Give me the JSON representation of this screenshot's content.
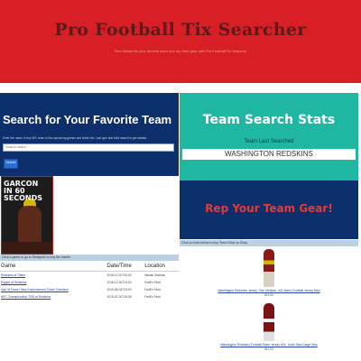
{
  "header": {
    "title": "Pro Football Tix Searcher",
    "tagline": "Find tickets for your favorite team and rep their gear with Pro Football Tix Searcher"
  },
  "search": {
    "heading": "Search for Your Favorite Team",
    "description": "Enter the name of any NFL team to find upcoming games and ticket info. Just type and click search to get started.",
    "placeholder": "Search team",
    "button_label": "Search"
  },
  "promo": {
    "title_line1": "GARCON",
    "title_line2": "IN 60",
    "title_line3": "SECONDS"
  },
  "games": {
    "caption": "Click a game to go to Seatgeek to buy the tickets",
    "columns": [
      "Game",
      "Date/Time",
      "Location"
    ],
    "rows": [
      {
        "game": "Redskins at Titans",
        "date": "2018-12-22T16:30",
        "location": "Nissan Stadium"
      },
      {
        "game": "Eagles at Redskins",
        "date": "2018-12-30T13:00",
        "location": "FedEx Field"
      },
      {
        "game": "Hall Of Fame Class Enshrinement Ticket: Redskins",
        "date": "2019-08-03T19:00",
        "location": "FedEx Field"
      },
      {
        "game": "NFC Championship: TBD at Redskins",
        "date": "2019-01-20T15:05",
        "location": "FedEx Field"
      }
    ]
  },
  "stats": {
    "heading": "Team Search Stats",
    "last_label": "Team Last Searched",
    "last_value": "WASHINGTON REDSKINS"
  },
  "gear": {
    "heading": "Rep Your Team Gear!",
    "caption": "Click on links below to buy Team Gear on Ebay",
    "products": [
      {
        "name": "Washington Redskins Jersey, Size Medium, #31 Mens Football Jersey New",
        "price": "$15.00"
      },
      {
        "name": "Washington Redskins Football Team Jersey #15, Youth Size Large New",
        "price": "$12.00"
      }
    ]
  },
  "colors": {
    "header": "#d91f26",
    "navy": "#0d2f6b",
    "teal": "#1fb7a2",
    "gear_heading": "#e23b3b"
  }
}
